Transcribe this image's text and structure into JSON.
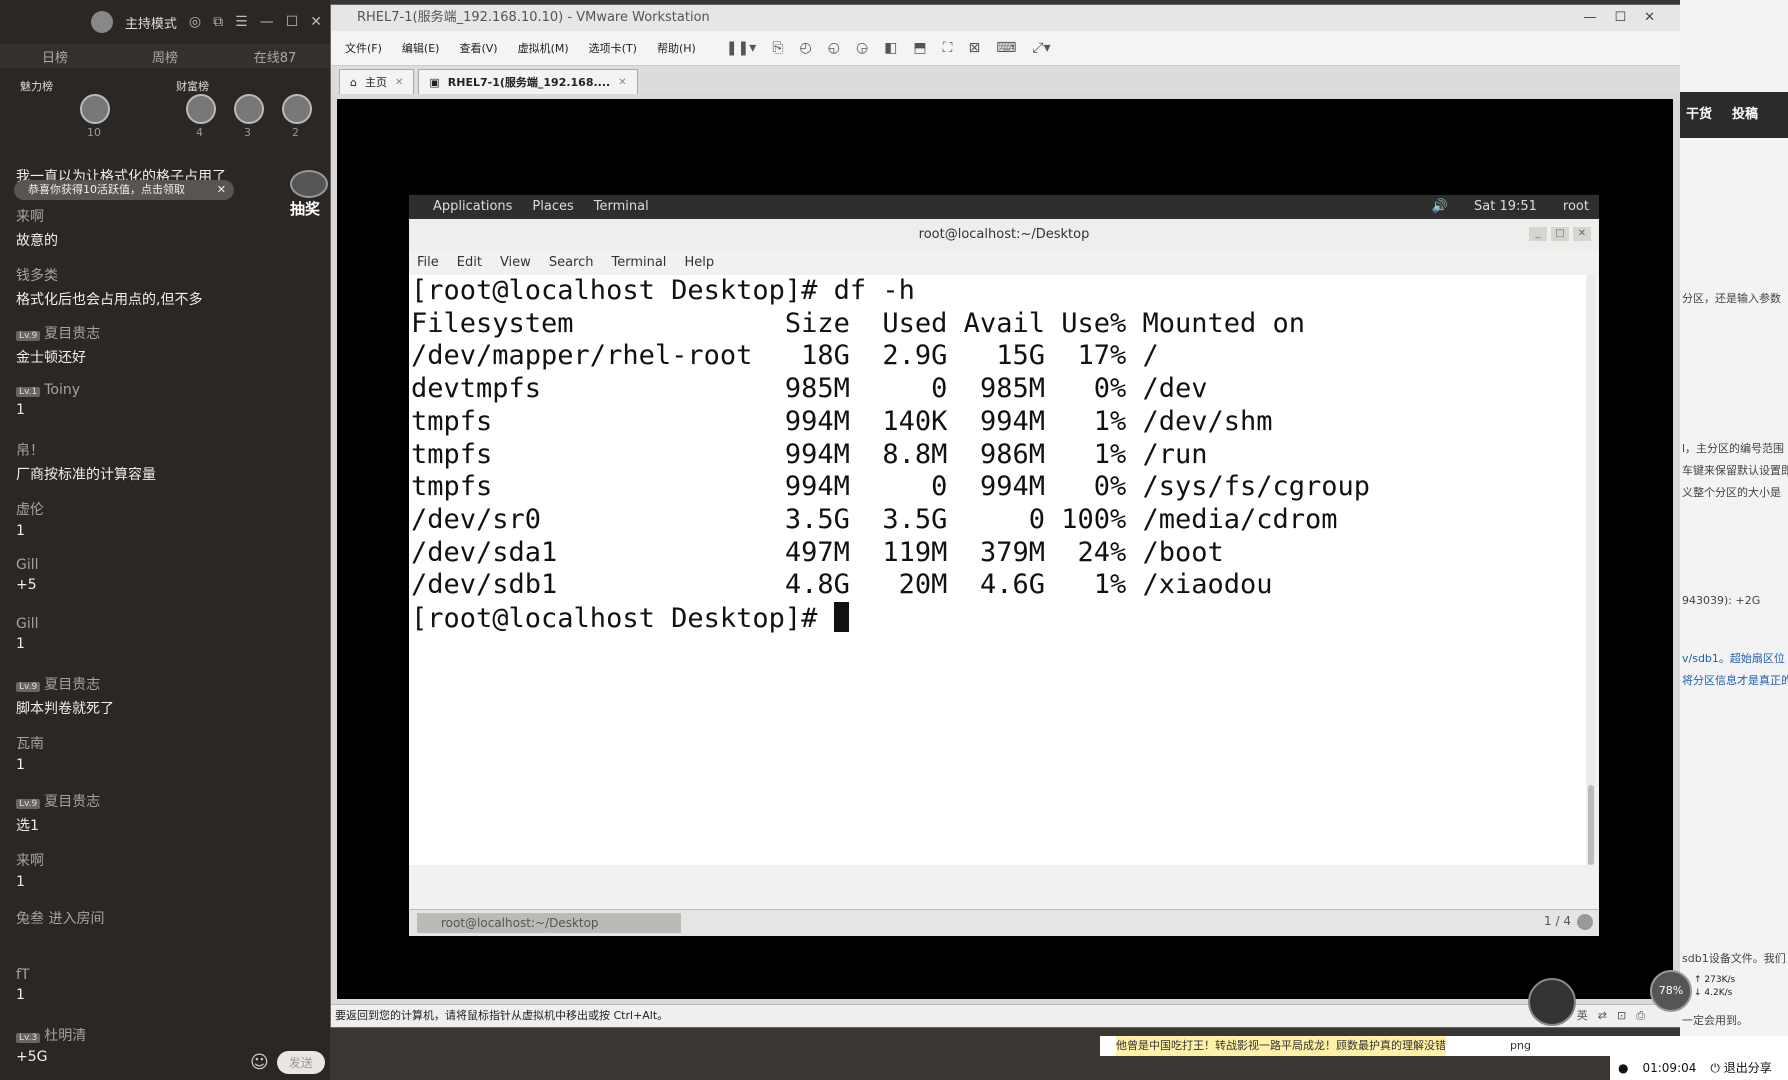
{
  "chat": {
    "mode_label": "主持模式",
    "tabs": [
      "日榜",
      "周榜",
      "在线87"
    ],
    "rank": {
      "charm_label": "魅力榜",
      "wealth_label": "财富榜",
      "counts": [
        "10",
        "4",
        "3",
        "2"
      ]
    },
    "top_text": "我一直以为让格式化的格子占用了",
    "notice": "恭喜你获得10活跃值，点击领取",
    "lottery_label": "抽奖",
    "messages": [
      {
        "user": "来啊",
        "text": "故意的"
      },
      {
        "user": "钱多类",
        "text": "格式化后也会占用点的,但不多"
      },
      {
        "badge": "Lv.9",
        "user": "夏目贵志",
        "text": "金士顿还好"
      },
      {
        "badge": "Lv.1",
        "user": "Toiny",
        "text": "1"
      },
      {
        "user": "帛！",
        "text": "厂商按标准的计算容量"
      },
      {
        "user": "虚伦",
        "text": "1"
      },
      {
        "user": "Gill",
        "text": "+5"
      },
      {
        "user": "Gill",
        "text": "1"
      },
      {
        "badge": "Lv.9",
        "user": "夏目贵志",
        "text": "脚本判卷就死了"
      },
      {
        "user": "瓦南",
        "text": "1"
      },
      {
        "badge": "Lv.9",
        "user": "夏目贵志",
        "text": "选1"
      },
      {
        "user": "来啊",
        "text": "1"
      },
      {
        "user": "兔叁 进入房间",
        "text": ""
      },
      {
        "user": "fT",
        "text": "1"
      },
      {
        "badge": "Lv.3",
        "user": "杜明清",
        "text": "+5G"
      }
    ],
    "send_label": "发送"
  },
  "vmware": {
    "title": "RHEL7-1(服务端_192.168.10.10) - VMware Workstation",
    "menu": [
      "文件(F)",
      "编辑(E)",
      "查看(V)",
      "虚拟机(M)",
      "选项卡(T)",
      "帮助(H)"
    ],
    "tabs": [
      {
        "label": "主页",
        "icon": "home-icon"
      },
      {
        "label": "RHEL7-1(服务端_192.168....",
        "icon": "vm-icon"
      }
    ],
    "status_text": "要返回到您的计算机，请将鼠标指针从虚拟机中移出或按 Ctrl+Alt。"
  },
  "gnome": {
    "applications": "Applications",
    "places": "Places",
    "terminal_app": "Terminal",
    "clock": "Sat 19:51",
    "user": "root"
  },
  "terminal": {
    "title": "root@localhost:~/Desktop",
    "menu": [
      "File",
      "Edit",
      "View",
      "Search",
      "Terminal",
      "Help"
    ],
    "lines": [
      "[root@localhost Desktop]# df -h",
      "Filesystem             Size  Used Avail Use% Mounted on",
      "/dev/mapper/rhel-root   18G  2.9G   15G  17% /",
      "devtmpfs               985M     0  985M   0% /dev",
      "tmpfs                  994M  140K  994M   1% /dev/shm",
      "tmpfs                  994M  8.8M  986M   1% /run",
      "tmpfs                  994M     0  994M   0% /sys/fs/cgroup",
      "/dev/sr0               3.5G  3.5G     0 100% /media/cdrom",
      "/dev/sda1              497M  119M  379M  24% /boot",
      "/dev/sdb1              4.8G   20M  4.6G   1% /xiaodou"
    ],
    "prompt": "[root@localhost Desktop]# ",
    "taskbar_item": "root@localhost:~/Desktop",
    "page_indicator": "1 / 4"
  },
  "right": {
    "nav": [
      "干货",
      "投稿"
    ],
    "snippets": [
      "分区，还是输入参数",
      "l，主分区的编号范围",
      "车键来保留默认设置即",
      "义整个分区的大小是",
      "943039): +2G",
      "v/sdb1。超始扇区位",
      "将分区信息才是真正的",
      "sdb1设备文件。我们",
      "一定会用到。"
    ],
    "gauge": "78%",
    "net_up": "273K/s",
    "net_down": "4.2K/s",
    "bottom_notice": "他曾是中国吃打王！转战影视一路平局成龙！顾数最护真的理解没错",
    "time": "01:09:04",
    "exit_share": "退出分享",
    "file_ext": "png"
  }
}
